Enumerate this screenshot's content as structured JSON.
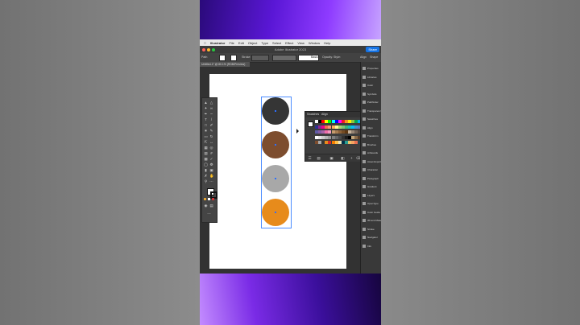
{
  "menu": {
    "app_name": "Illustrator",
    "items": [
      "File",
      "Edit",
      "Object",
      "Type",
      "Select",
      "Effect",
      "View",
      "Window",
      "Help"
    ]
  },
  "window": {
    "title": "Adobe Illustrator 2023",
    "share_label": "Share"
  },
  "control_bar": {
    "path_label": "Path",
    "stroke_label": "Stroke:",
    "basic_label": "Basic",
    "opacity_label": "Opacity:",
    "style_label": "Style:",
    "align_label": "Align",
    "shape_label": "Shape"
  },
  "document": {
    "tab_title": "Untitled-1* @ 80.1% (RGB/Preview)"
  },
  "canvas": {
    "circles": [
      {
        "name": "circle-charcoal",
        "color": "#353535"
      },
      {
        "name": "circle-brown",
        "color": "#7d4d2e"
      },
      {
        "name": "circle-gray",
        "color": "#a8a8a8"
      },
      {
        "name": "circle-orange",
        "color": "#e78b1b"
      }
    ]
  },
  "swatches_panel": {
    "tabs": [
      "Swatches",
      "Align"
    ]
  },
  "right_panels": [
    "Properties",
    "Libraries",
    "Color",
    "Symbols",
    "Pathfinder",
    "Transparency",
    "Swatches",
    "Align",
    "Transform",
    "Brushes",
    "Artboards",
    "Asset Export",
    "Character",
    "Paragraph",
    "Gradient",
    "Layers",
    "OpenType",
    "Color Guide",
    "3D and Materials",
    "Stroke",
    "Navigator",
    "Info"
  ]
}
